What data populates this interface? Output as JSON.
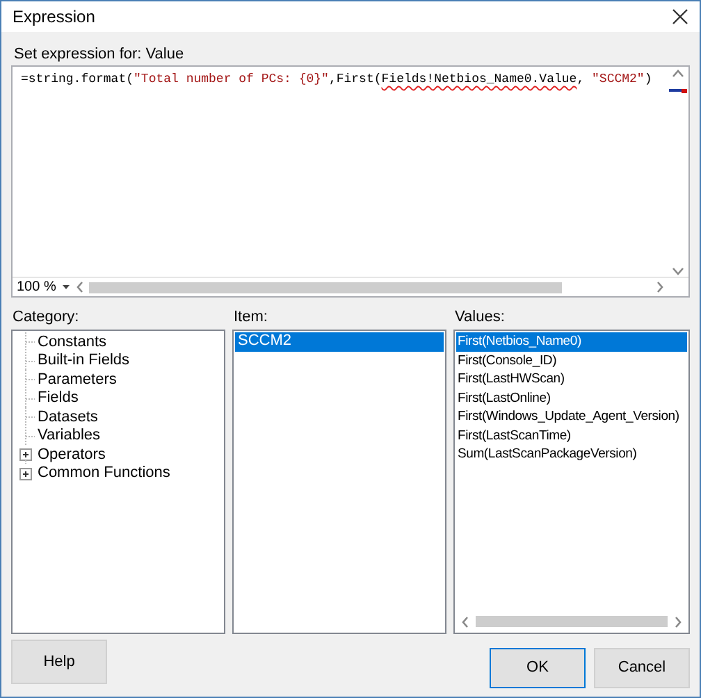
{
  "window": {
    "title": "Expression"
  },
  "prompt": "Set expression for: Value",
  "expression": [
    {
      "text": "=string.format(",
      "kind": "plain"
    },
    {
      "text": "\"Total number of PCs: {0}\"",
      "kind": "string"
    },
    {
      "text": ",First(",
      "kind": "plain"
    },
    {
      "text": "Fields!Netbios_Name0.Value",
      "kind": "error"
    },
    {
      "text": ", ",
      "kind": "plain"
    },
    {
      "text": "\"SCCM2\"",
      "kind": "string"
    },
    {
      "text": ")",
      "kind": "plain"
    }
  ],
  "zoom": "100 %",
  "category": {
    "label": "Category:",
    "items": [
      {
        "label": "Constants",
        "kind": "leaf"
      },
      {
        "label": "Built-in Fields",
        "kind": "leaf"
      },
      {
        "label": "Parameters",
        "kind": "leaf"
      },
      {
        "label": "Fields",
        "kind": "leaf"
      },
      {
        "label": "Datasets",
        "kind": "leaf"
      },
      {
        "label": "Variables",
        "kind": "leaf"
      },
      {
        "label": "Operators",
        "kind": "group",
        "expanded": false
      },
      {
        "label": "Common Functions",
        "kind": "group",
        "expanded": false
      }
    ]
  },
  "item": {
    "label": "Item:",
    "items": [
      {
        "label": "SCCM2",
        "selected": true
      }
    ]
  },
  "values": {
    "label": "Values:",
    "items": [
      {
        "label": "First(Netbios_Name0)",
        "selected": true
      },
      {
        "label": "First(Console_ID)",
        "selected": false
      },
      {
        "label": "First(LastHWScan)",
        "selected": false
      },
      {
        "label": "First(LastOnline)",
        "selected": false
      },
      {
        "label": "First(Windows_Update_Agent_Version)",
        "selected": false
      },
      {
        "label": "First(LastScanTime)",
        "selected": false
      },
      {
        "label": "Sum(LastScanPackageVersion)",
        "selected": false
      }
    ]
  },
  "buttons": [
    {
      "label": "Help",
      "kind": "help",
      "default": false
    },
    {
      "label": "OK",
      "kind": "ok",
      "default": true
    },
    {
      "label": "Cancel",
      "kind": "cancel",
      "default": false
    }
  ]
}
